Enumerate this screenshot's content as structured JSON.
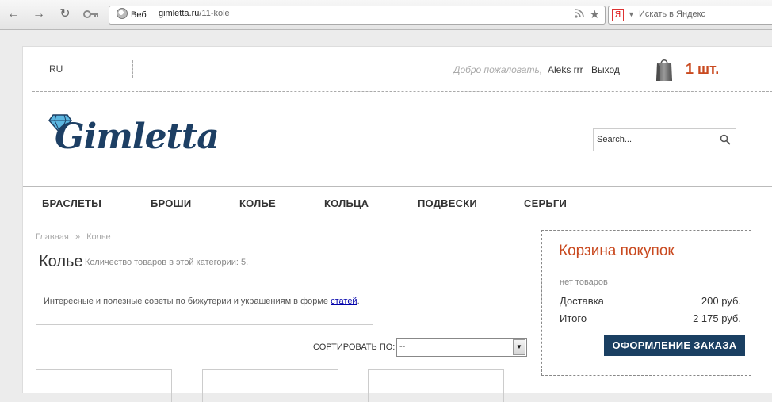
{
  "browser": {
    "site_badge": "Веб",
    "url_host": "gimletta.ru",
    "url_path": "/11-kole",
    "search_engine_badge": "Я",
    "search_placeholder": "Искать в Яндекс"
  },
  "header": {
    "language": "RU",
    "welcome": "Добро пожаловать,",
    "user": "Aleks rrr",
    "logout": "Выход",
    "cart_count": "1 шт."
  },
  "logo": {
    "text": "Gimletta"
  },
  "search": {
    "placeholder": "Search..."
  },
  "menu": {
    "items": [
      "БРАСЛЕТЫ",
      "БРОШИ",
      "КОЛЬЕ",
      "КОЛЬЦА",
      "ПОДВЕСКИ",
      "СЕРЬГИ"
    ]
  },
  "breadcrumb": {
    "home": "Главная",
    "separator": "»",
    "current": "Колье"
  },
  "category": {
    "title": "Колье",
    "count_text": "Количество товаров в этой категории: 5."
  },
  "info": {
    "text": "Интересные и полезные советы по бижутерии и украшениям в форме",
    "link": "статей",
    "end": "."
  },
  "sort": {
    "label": "СОРТИРОВАТЬ ПО:",
    "value": "--"
  },
  "cart": {
    "title": "Корзина покупок",
    "empty": "нет товаров",
    "shipping_label": "Доставка",
    "shipping_value": "200 руб.",
    "total_label": "Итого",
    "total_value": "2 175 руб.",
    "checkout": "ОФОРМЛЕНИЕ ЗАКАЗА"
  },
  "colors": {
    "brand": "#1a3f62",
    "accent": "#c9491f"
  }
}
